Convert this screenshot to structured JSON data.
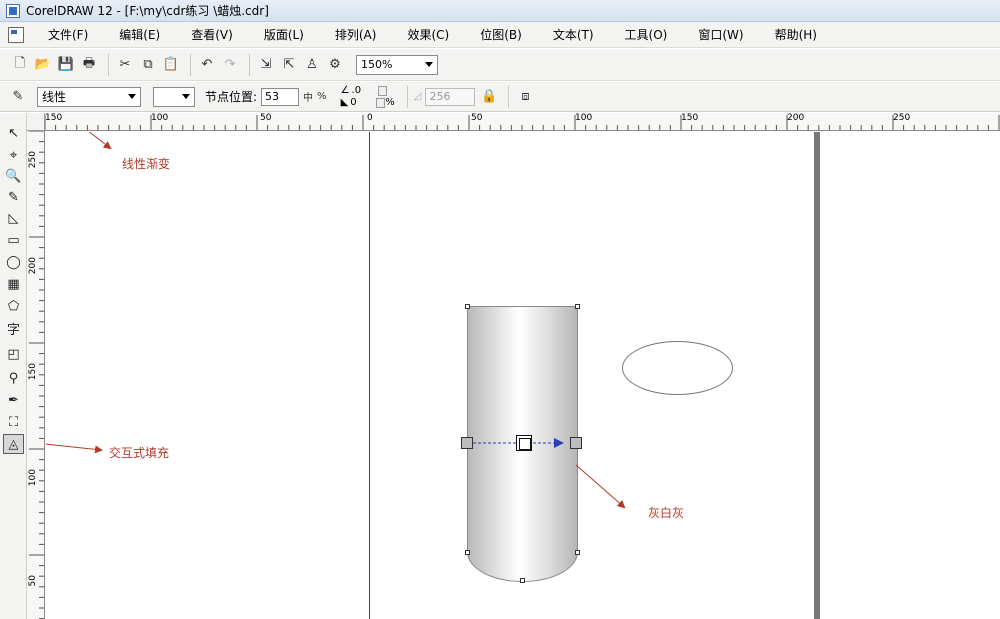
{
  "window": {
    "title": "CorelDRAW 12 - [F:\\my\\cdr练习  \\蜡烛.cdr]"
  },
  "menu": [
    "文件(F)",
    "编辑(E)",
    "查看(V)",
    "版面(L)",
    "排列(A)",
    "效果(C)",
    "位图(B)",
    "文本(T)",
    "工具(O)",
    "窗口(W)",
    "帮助(H)"
  ],
  "toolbar": {
    "zoom": "150%"
  },
  "property_bar": {
    "fill_type": "线性",
    "node_position_label": "节点位置:",
    "node_position_value": "53",
    "percent": "%",
    "angle_value": ".0",
    "edge_value": "0",
    "steps_value": "256"
  },
  "rulers": {
    "h_labels": [
      "150",
      "100",
      "50",
      "0",
      "50",
      "100",
      "150",
      "200",
      "250"
    ],
    "v_labels": [
      "250",
      "200",
      "150",
      "100",
      "50"
    ]
  },
  "annotations": {
    "linear_gradient": "线性渐变",
    "interactive_fill": "交互式填充",
    "grey_white_grey": "灰白灰"
  },
  "colors": {
    "annotation": "#b23a2a",
    "gradient_arrow": "#2b3fb3"
  },
  "icons": [
    "new-icon",
    "open-icon",
    "save-icon",
    "print-icon",
    "cut-icon",
    "copy-icon",
    "paste-icon",
    "undo-icon",
    "redo-icon",
    "import-icon",
    "export-icon",
    "launcher-icon",
    "zoom-icon"
  ]
}
